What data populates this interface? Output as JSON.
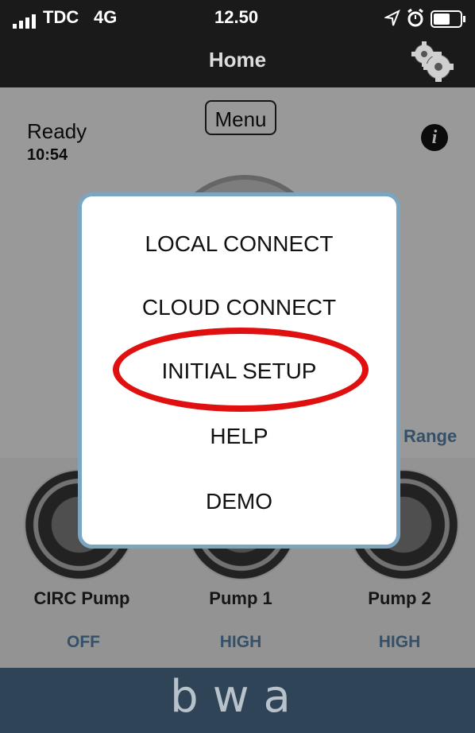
{
  "status_bar": {
    "carrier": "TDC",
    "network": "4G",
    "time": "12.50"
  },
  "nav": {
    "title": "Home",
    "settings_icon": "gears-icon"
  },
  "main": {
    "menu_button": "Menu",
    "status_label": "Ready",
    "status_time": "10:54",
    "info_icon": "i",
    "range_label": "Range"
  },
  "pumps": [
    {
      "label": "CIRC Pump",
      "state": "OFF"
    },
    {
      "label": "Pump 1",
      "state": "HIGH"
    },
    {
      "label": "Pump 2",
      "state": "HIGH"
    }
  ],
  "menu_modal": {
    "items": [
      "LOCAL CONNECT",
      "CLOUD CONNECT",
      "INITIAL SETUP",
      "HELP",
      "DEMO"
    ],
    "highlighted": "INITIAL SETUP"
  },
  "footer": {
    "brand": "bwa"
  },
  "colors": {
    "bar_bg": "#1a1a1a",
    "footer_bg": "#2f4456",
    "modal_border": "#7aa6c2",
    "highlight": "#e01010",
    "pump_state": "#4e7a9d"
  }
}
